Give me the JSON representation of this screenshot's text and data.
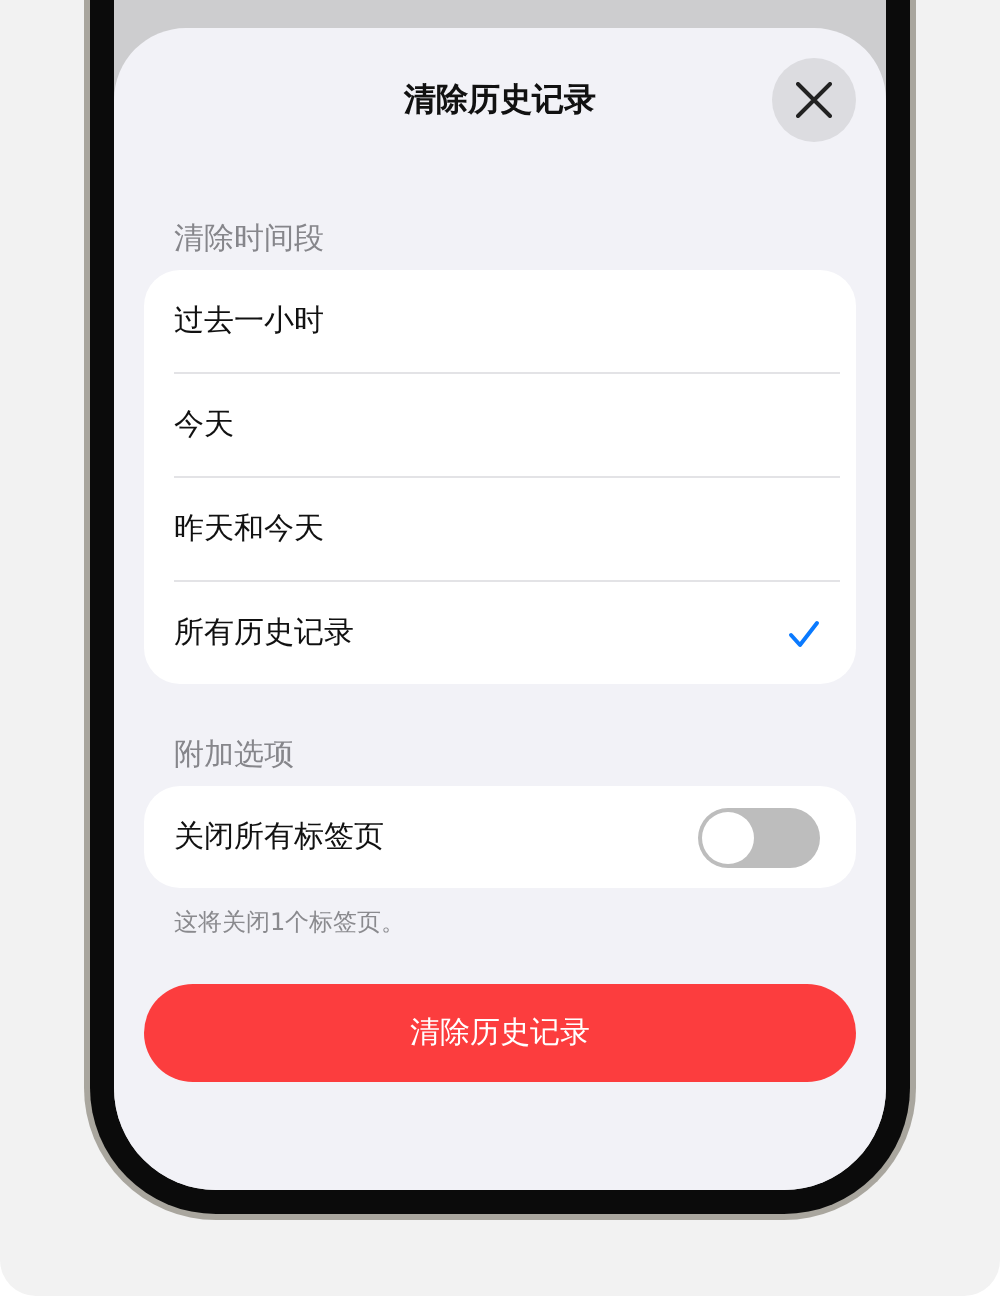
{
  "sheet": {
    "title": "清除历史记录"
  },
  "time_range": {
    "header": "清除时间段",
    "options": [
      {
        "label": "过去一小时",
        "selected": false
      },
      {
        "label": "今天",
        "selected": false
      },
      {
        "label": "昨天和今天",
        "selected": false
      },
      {
        "label": "所有历史记录",
        "selected": true
      }
    ]
  },
  "extra_options": {
    "header": "附加选项",
    "toggle": {
      "label": "关闭所有标签页",
      "on": false
    },
    "footnote": "这将关闭1个标签页。"
  },
  "primary_button": "清除历史记录"
}
